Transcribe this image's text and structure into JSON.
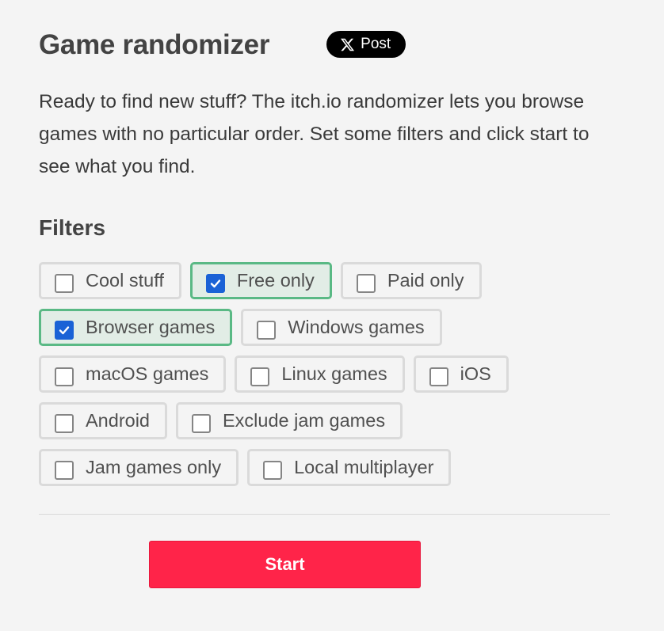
{
  "header": {
    "title": "Game randomizer",
    "share_button_label": "Post",
    "share_icon": "x-logo-icon"
  },
  "description": "Ready to find new stuff? The itch.io randomizer lets you browse games with no particular order. Set some filters and click start to see what you find.",
  "filters": {
    "heading": "Filters",
    "items": [
      {
        "label": "Cool stuff",
        "checked": false
      },
      {
        "label": "Free only",
        "checked": true
      },
      {
        "label": "Paid only",
        "checked": false
      },
      {
        "label": "Browser games",
        "checked": true
      },
      {
        "label": "Windows games",
        "checked": false
      },
      {
        "label": "macOS games",
        "checked": false
      },
      {
        "label": "Linux games",
        "checked": false
      },
      {
        "label": "iOS",
        "checked": false
      },
      {
        "label": "Android",
        "checked": false
      },
      {
        "label": "Exclude jam games",
        "checked": false
      },
      {
        "label": "Jam games only",
        "checked": false
      },
      {
        "label": "Local multiplayer",
        "checked": false
      }
    ]
  },
  "actions": {
    "start_label": "Start"
  },
  "colors": {
    "start_button": "#ff2449",
    "checked_border": "#5ab985",
    "checked_background": "#e2ede6",
    "checkbox_checked": "#1a62d6",
    "page_background": "#f4f4f4"
  }
}
